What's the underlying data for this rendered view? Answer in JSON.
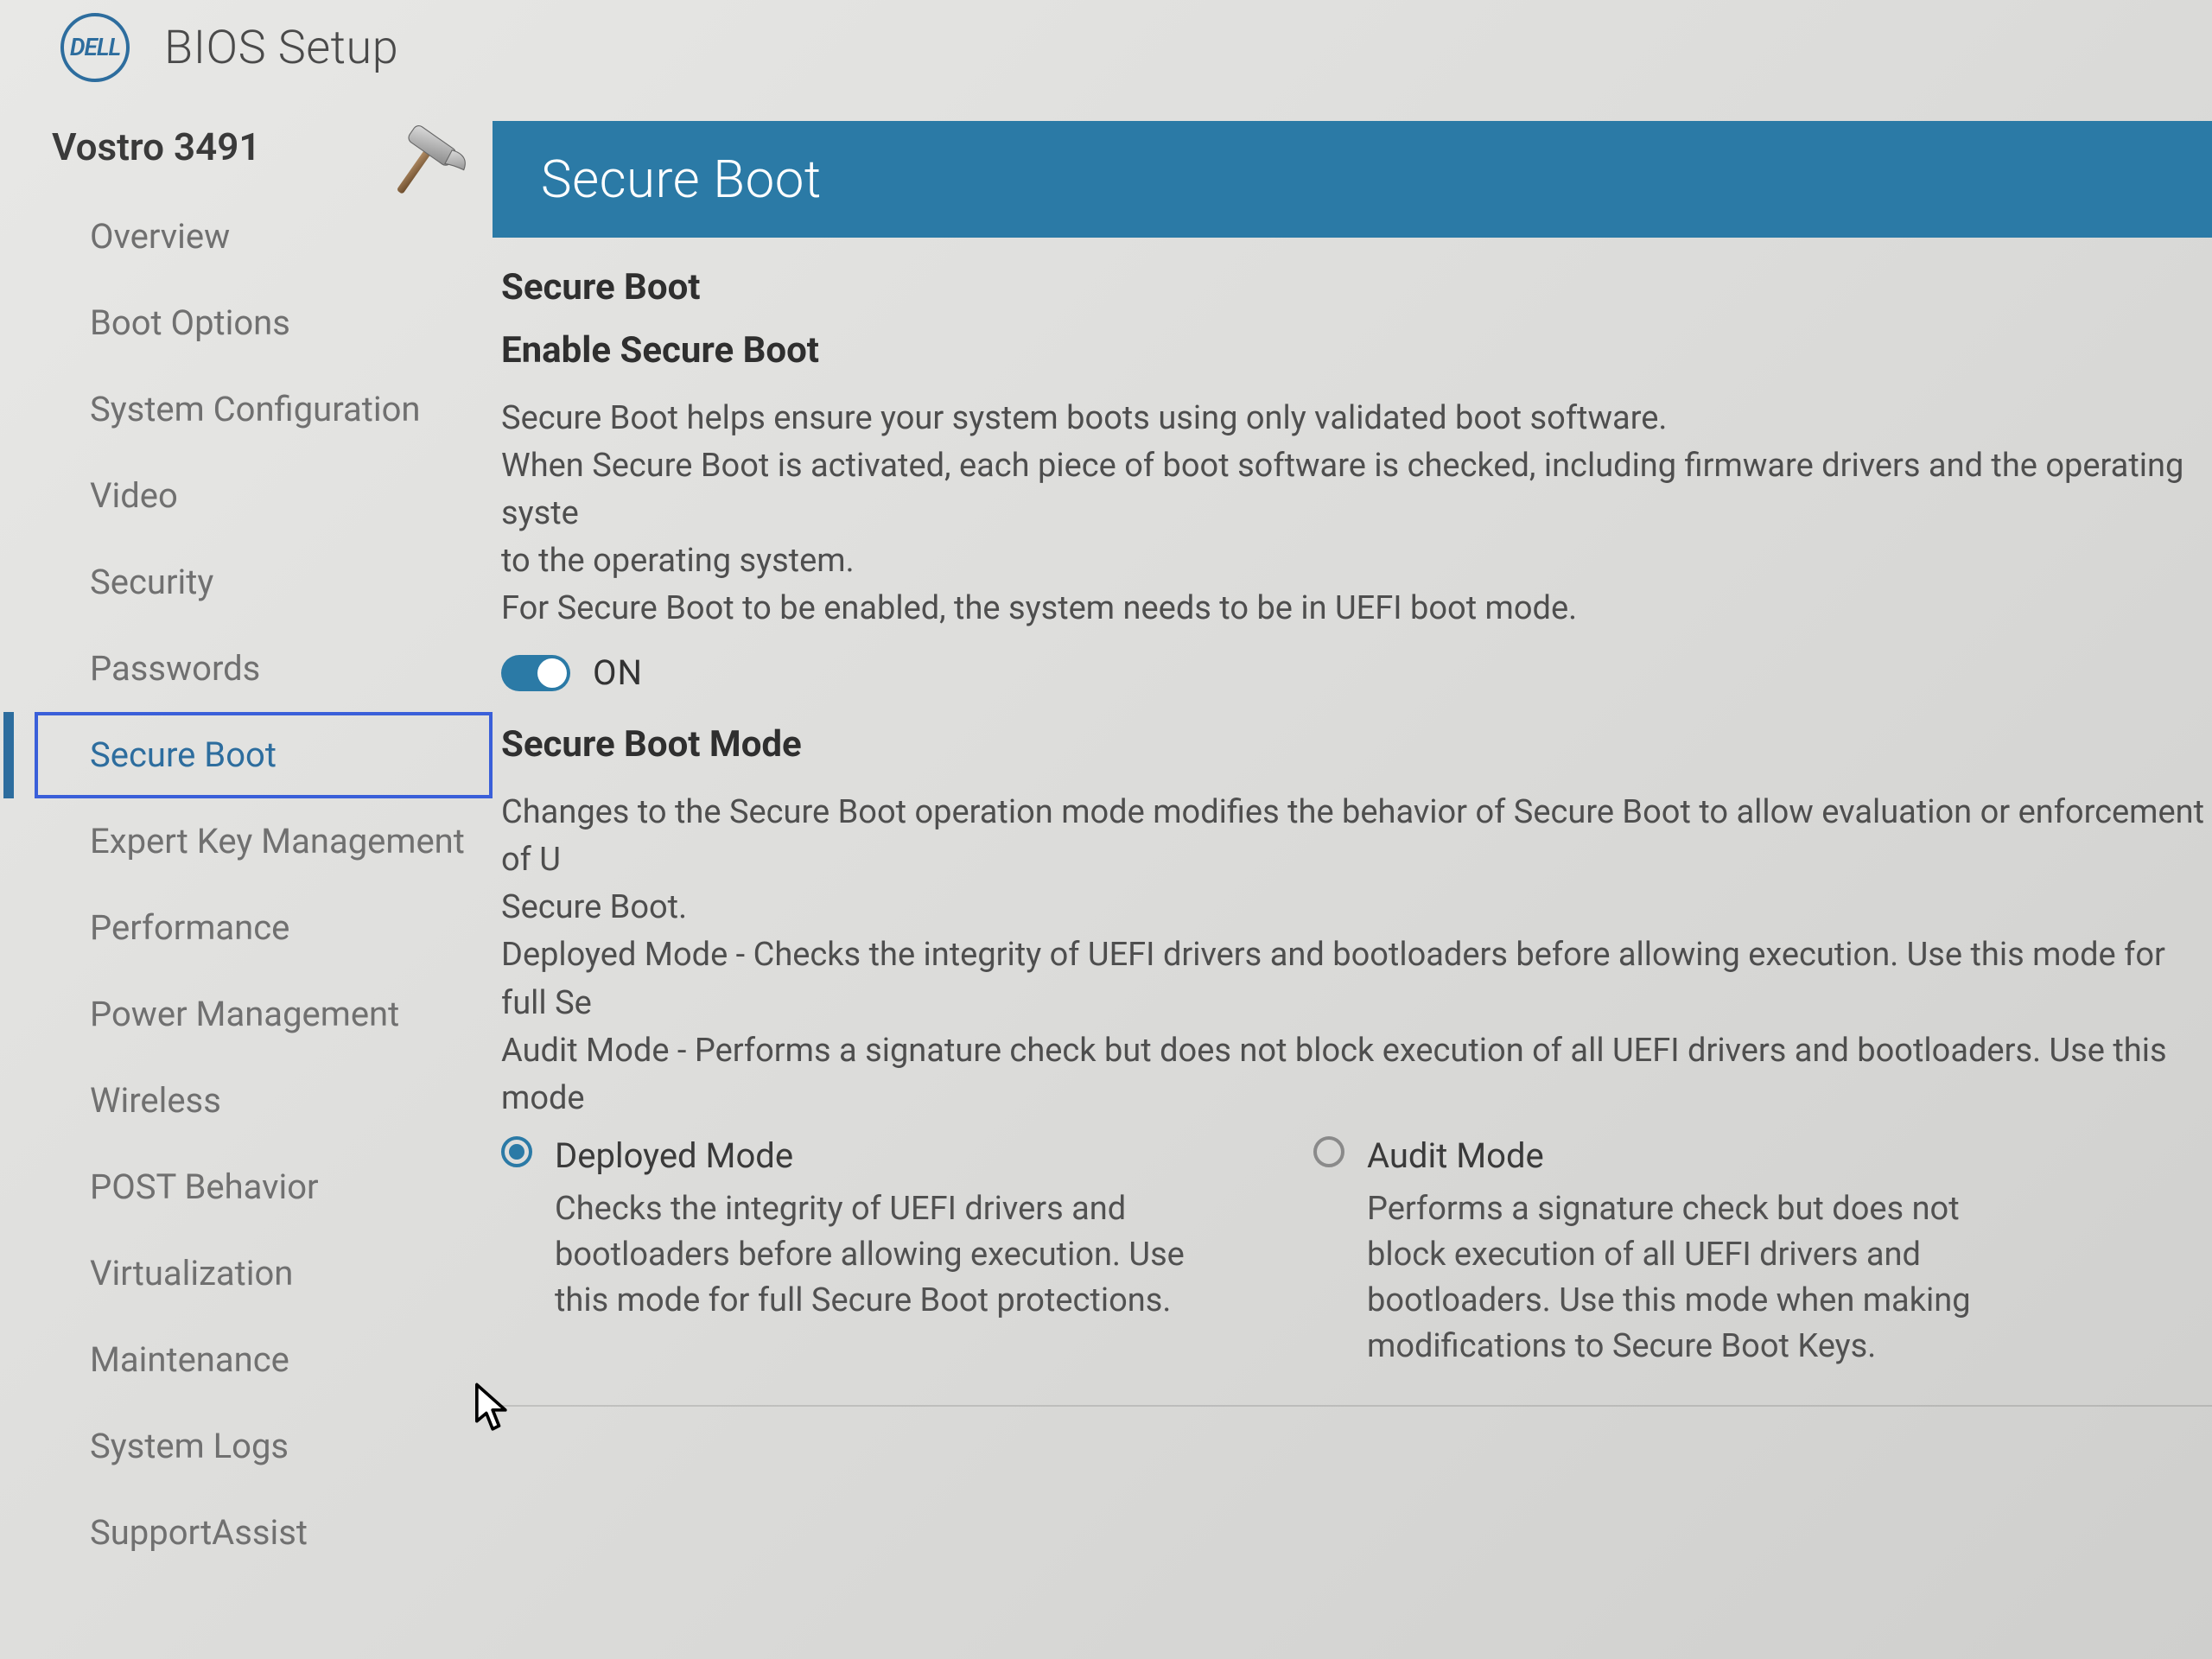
{
  "brand": {
    "logo_text": "DELL",
    "app_title": "BIOS Setup"
  },
  "sidebar": {
    "model": "Vostro 3491",
    "items": [
      {
        "label": "Overview"
      },
      {
        "label": "Boot Options"
      },
      {
        "label": "System Configuration"
      },
      {
        "label": "Video"
      },
      {
        "label": "Security"
      },
      {
        "label": "Passwords"
      },
      {
        "label": "Secure Boot",
        "selected": true
      },
      {
        "label": "Expert Key Management"
      },
      {
        "label": "Performance"
      },
      {
        "label": "Power Management"
      },
      {
        "label": "Wireless"
      },
      {
        "label": "POST Behavior"
      },
      {
        "label": "Virtualization"
      },
      {
        "label": "Maintenance"
      },
      {
        "label": "System Logs"
      },
      {
        "label": "SupportAssist"
      }
    ]
  },
  "content": {
    "banner": "Secure Boot",
    "section_title": "Secure Boot",
    "enable": {
      "title": "Enable Secure Boot",
      "desc_lines": [
        "Secure Boot helps ensure your system boots using only validated boot software.",
        " When Secure Boot is activated, each piece of boot software is checked, including firmware drivers and the operating syste",
        "to the operating system.",
        "For Secure Boot to be enabled, the system needs to be in UEFI boot mode."
      ],
      "toggle": {
        "state": "ON",
        "on": true
      }
    },
    "mode": {
      "title": "Secure Boot Mode",
      "desc_lines": [
        "Changes to the Secure Boot operation mode modifies the behavior of Secure Boot to allow evaluation or enforcement of U",
        "Secure Boot.",
        "Deployed Mode - Checks the integrity of UEFI drivers and bootloaders before allowing execution. Use this mode for full Se",
        "Audit Mode - Performs a signature check but does not block execution of all UEFI drivers and bootloaders.  Use this mode"
      ],
      "options": [
        {
          "label": "Deployed Mode",
          "help": "Checks the integrity of UEFI drivers and bootloaders before allowing execution. Use this mode for full Secure Boot protections.",
          "checked": true
        },
        {
          "label": "Audit Mode",
          "help": "Performs a signature check but does not block execution of all UEFI drivers and bootloaders.  Use this mode when making modifications to Secure Boot Keys.",
          "checked": false
        }
      ]
    }
  },
  "colors": {
    "accent": "#2b7aa6",
    "selection": "#3a5fd9"
  }
}
